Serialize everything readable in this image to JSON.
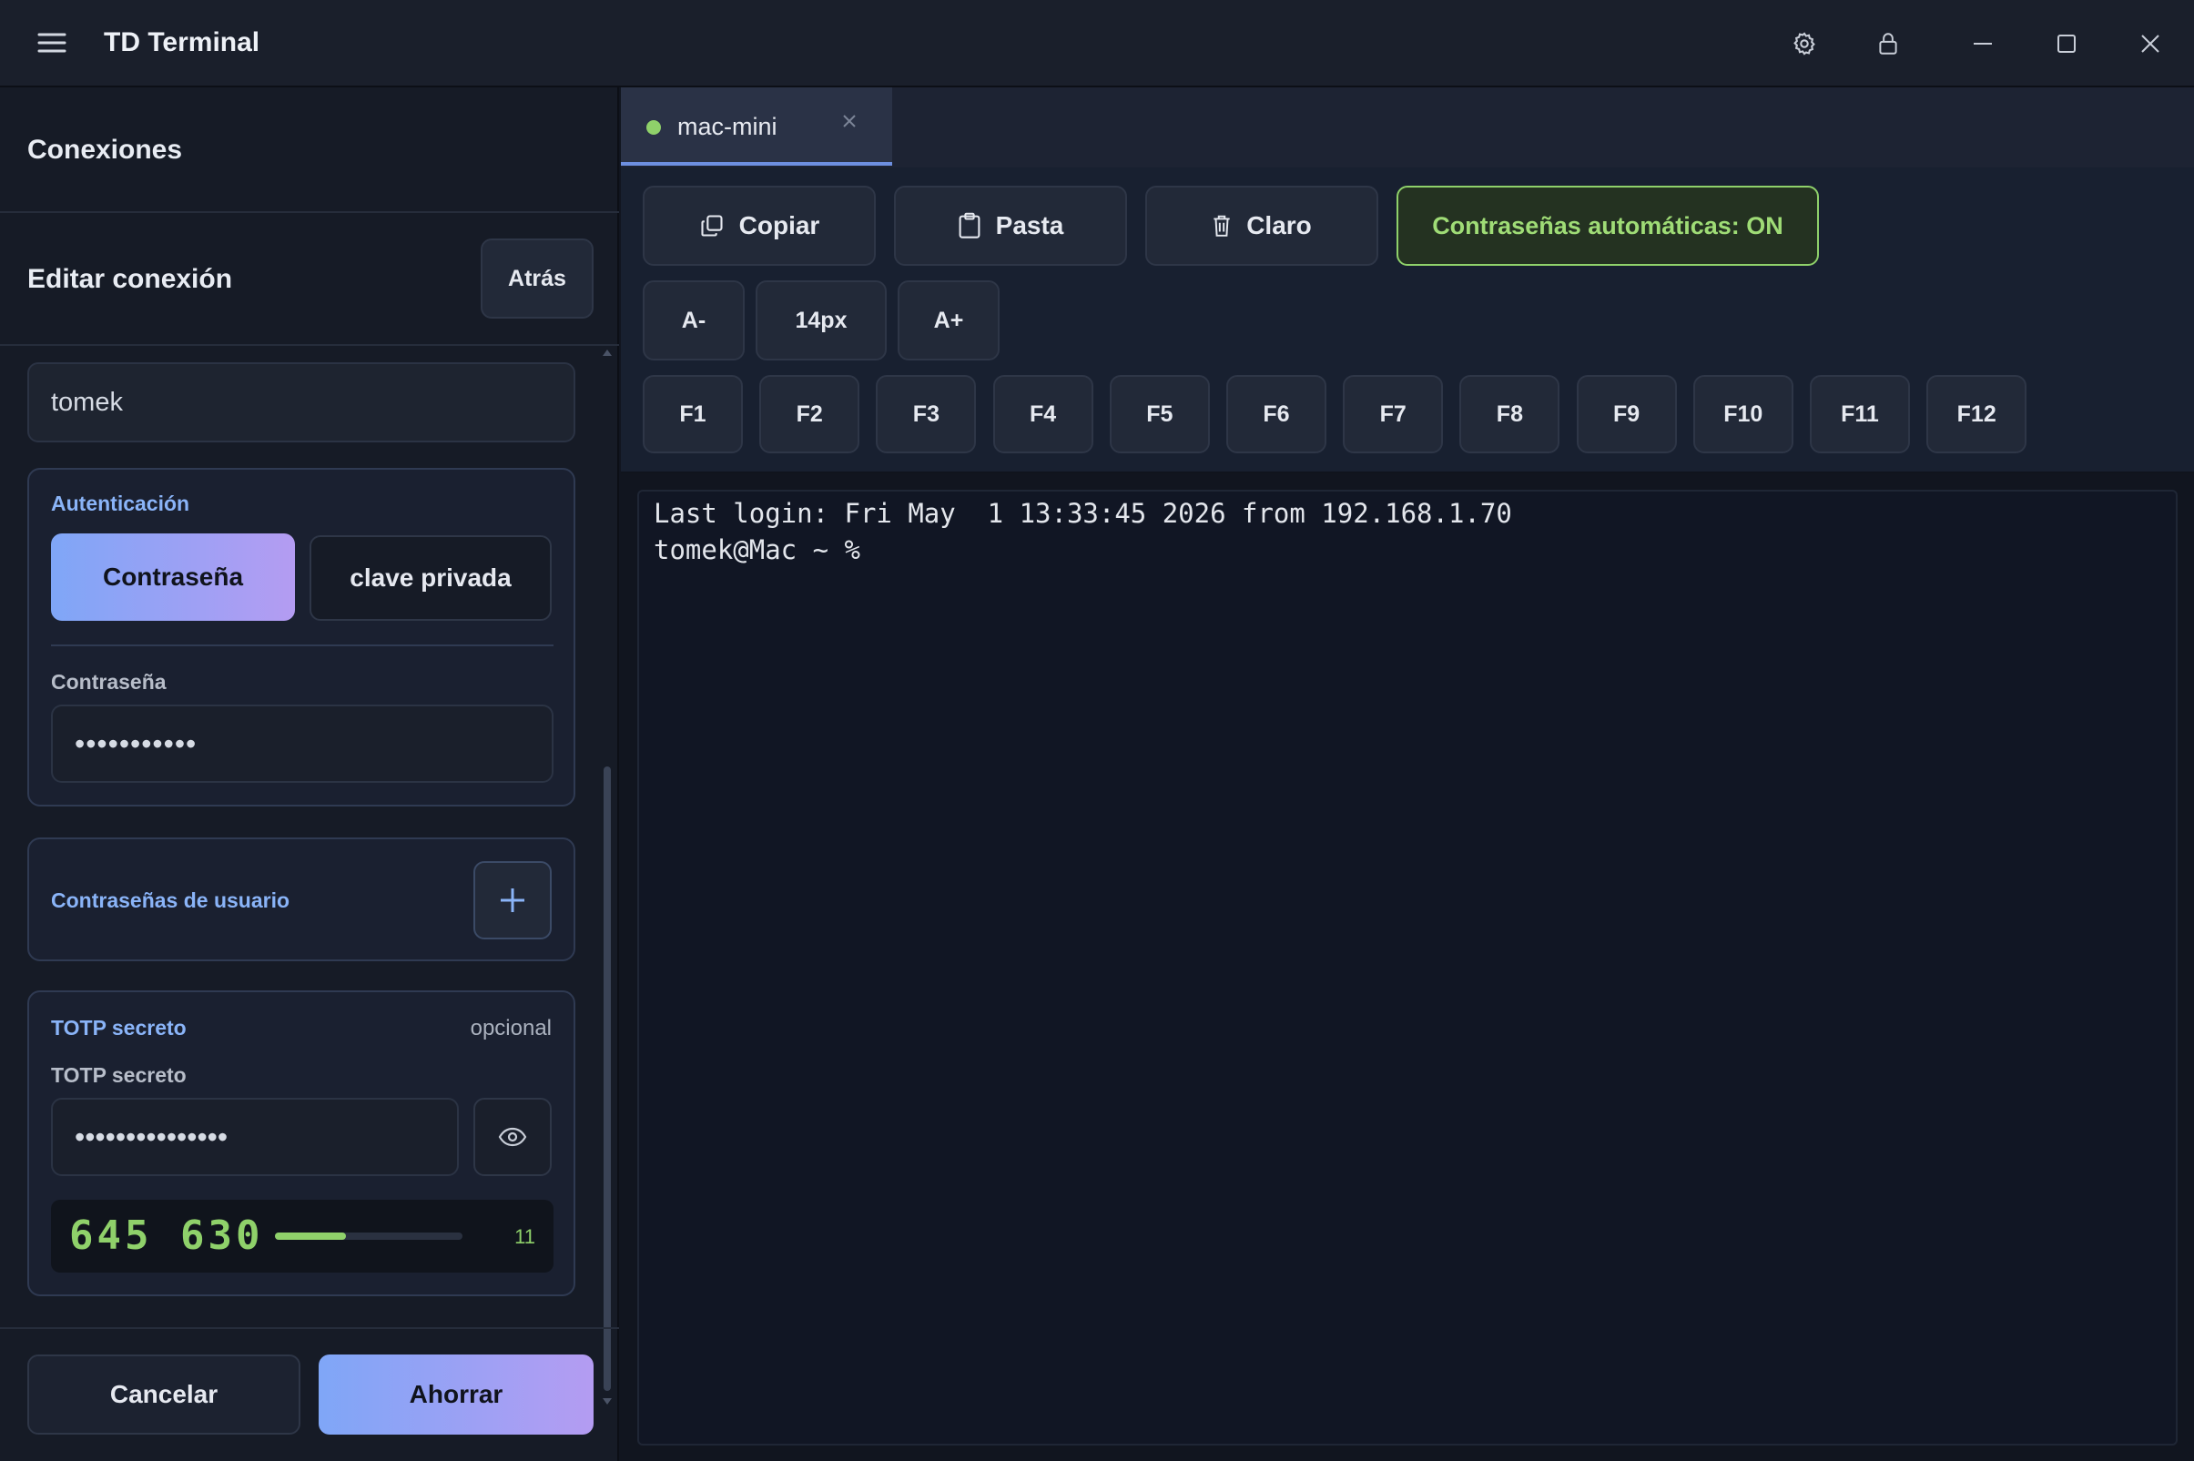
{
  "app": {
    "title": "TD Terminal"
  },
  "left_panel": {
    "section_title": "Conexiones",
    "edit_title": "Editar conexión",
    "back_label": "Atrás",
    "username_value": "tomek",
    "auth": {
      "title": "Autenticación",
      "options": [
        "Contraseña",
        "clave privada"
      ],
      "selected": "Contraseña",
      "password_label": "Contraseña",
      "password_value": "•••••••••••"
    },
    "user_passwords": {
      "label": "Contraseñas de usuario"
    },
    "totp": {
      "title": "TOTP secreto",
      "optional": "opcional",
      "field_label": "TOTP secreto",
      "value": "•••••••••••••••",
      "code": "645 630",
      "seconds_left": "11",
      "progress": 0.38
    },
    "cancel_label": "Cancelar",
    "save_label": "Ahorrar"
  },
  "tabs": [
    {
      "label": "mac-mini",
      "status_color": "#8fd16a"
    }
  ],
  "toolbar": {
    "copy": "Copiar",
    "paste": "Pasta",
    "clear": "Claro",
    "auto_passwords": "Contraseñas automáticas: ON",
    "font_dec": "A-",
    "font_size": "14px",
    "font_inc": "A+",
    "fkeys": [
      "F1",
      "F2",
      "F3",
      "F4",
      "F5",
      "F6",
      "F7",
      "F8",
      "F9",
      "F10",
      "F11",
      "F12"
    ]
  },
  "terminal": {
    "lines": [
      "Last login: Fri May  1 13:33:45 2026 from 192.168.1.70",
      "tomek@Mac ~ % "
    ]
  },
  "colors": {
    "accent_green": "#8fd16a",
    "accent_blue": "#8ab4f8",
    "gradient_start": "#7fa6f7",
    "gradient_end": "#b49cf2"
  }
}
